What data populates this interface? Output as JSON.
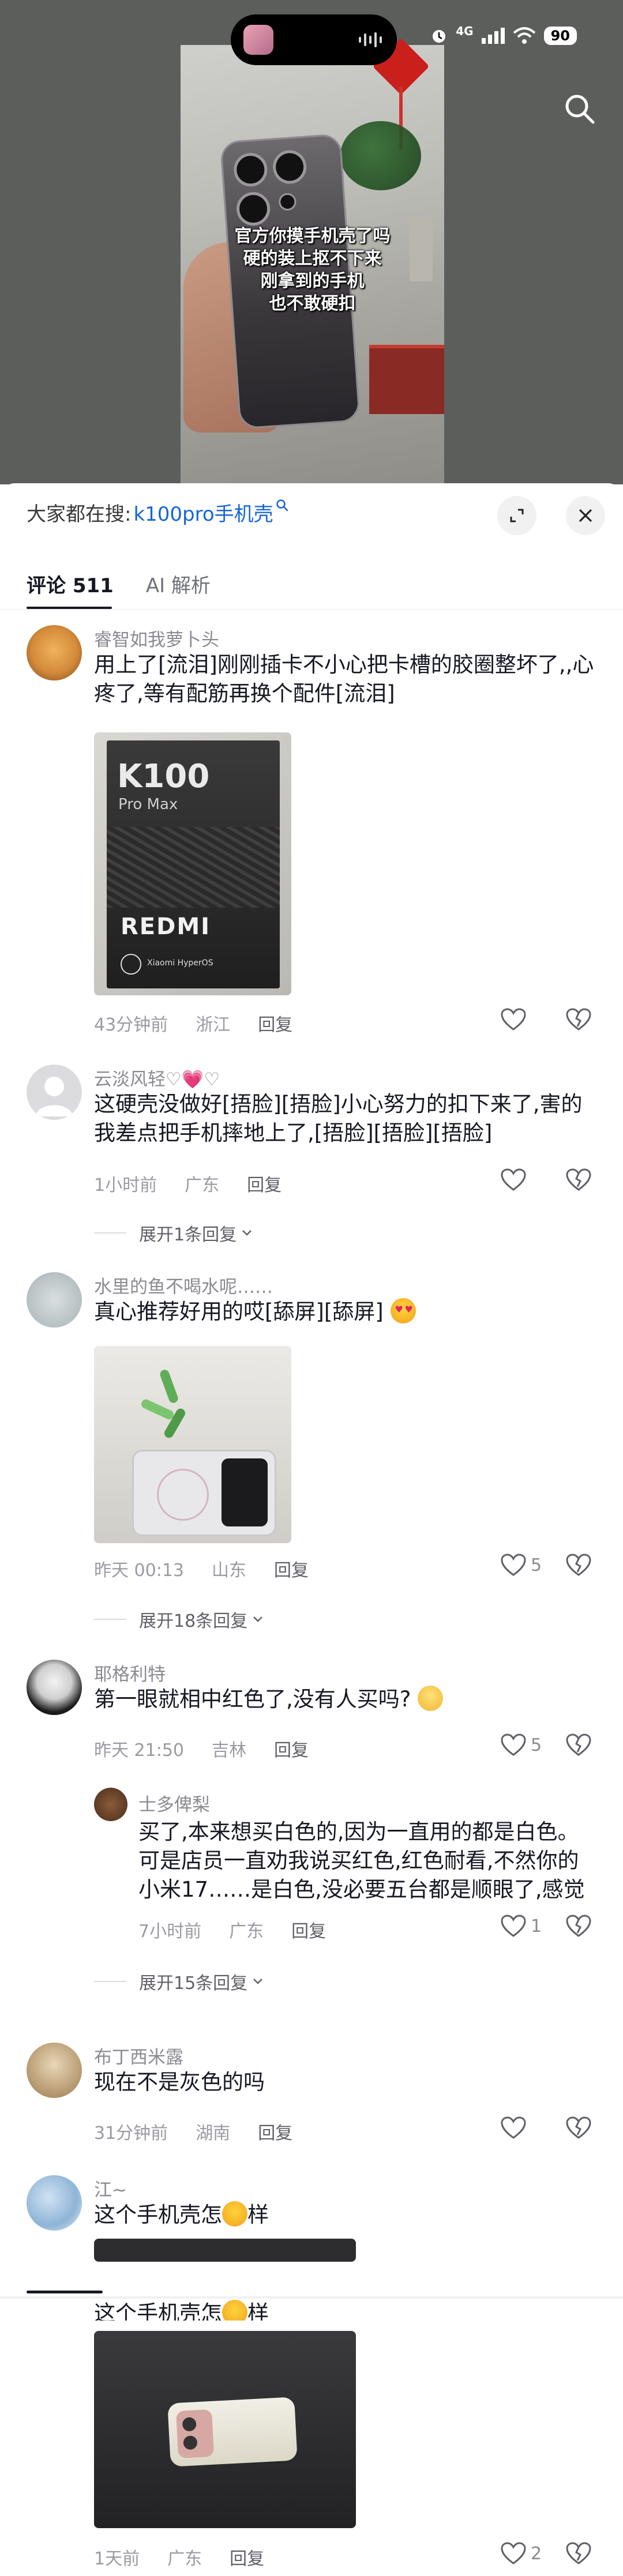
{
  "status_bar": {
    "network": "4G",
    "battery": "90"
  },
  "video": {
    "overlay_lines": [
      "官方你摸手机壳了吗",
      "硬的装上抠不下来",
      "刚拿到的手机",
      "也不敢硬扣"
    ]
  },
  "search_hint": {
    "prefix": "大家都在搜:",
    "query": "k100pro手机壳"
  },
  "tabs": [
    {
      "label": "评论 511",
      "active": true
    },
    {
      "label": "AI 解析",
      "active": false
    }
  ],
  "comments": [
    {
      "username": "睿智如我萝卜头",
      "text": "用上了[流泪]刚刚插卡不小心把卡槽的胶圈整坏了,,心疼了,等有配筋再换个配件[流泪]",
      "image": {
        "brand": "K100",
        "model": "Pro Max",
        "logo": "REDMI",
        "os": "Xiaomi HyperOS"
      },
      "time": "43分钟前",
      "location": "浙江",
      "reply": "回复",
      "likes": ""
    },
    {
      "username": "云淡风轻♡💗♡",
      "text": "这硬壳没做好[捂脸][捂脸]小心努力的扣下来了,害的我差点把手机摔地上了,[捂脸][捂脸][捂脸]",
      "time": "1小时前",
      "location": "广东",
      "reply": "回复",
      "likes": "",
      "expand": "展开1条回复"
    },
    {
      "username": "水里的鱼不喝水呢……",
      "text": "真心推荐好用的哎[舔屏][舔屏]",
      "time": "昨天 00:13",
      "location": "山东",
      "reply": "回复",
      "likes": "5",
      "expand": "展开18条回复"
    },
    {
      "username": "耶格利特",
      "text": "第一眼就相中红色了,没有人买吗?",
      "time": "昨天 21:50",
      "location": "吉林",
      "reply": "回复",
      "likes": "5"
    },
    {
      "username": "士多俾梨",
      "text": "买了,本来想买白色的,因为一直用的都是白色。可是店员一直劝我说买红色,红色耐看,不然你的小米17……是白色,没必要五台都是顺眼了,感觉还挺好看",
      "time": "7小时前",
      "location": "广东",
      "reply": "回复",
      "likes": "1",
      "expand": "展开15条回复"
    },
    {
      "username": "布丁西米露",
      "text": "现在不是灰色的吗",
      "time": "31分钟前",
      "location": "湖南",
      "reply": "回复",
      "likes": ""
    },
    {
      "username": "江~",
      "text_before": "这个手机壳怎",
      "text_after": "样",
      "time": "1天前",
      "location": "广东",
      "reply": "回复",
      "likes": "2"
    }
  ],
  "colors": {
    "accent_blue": "#1565d8",
    "text_primary": "#161823",
    "text_secondary": "#8a8b91"
  }
}
